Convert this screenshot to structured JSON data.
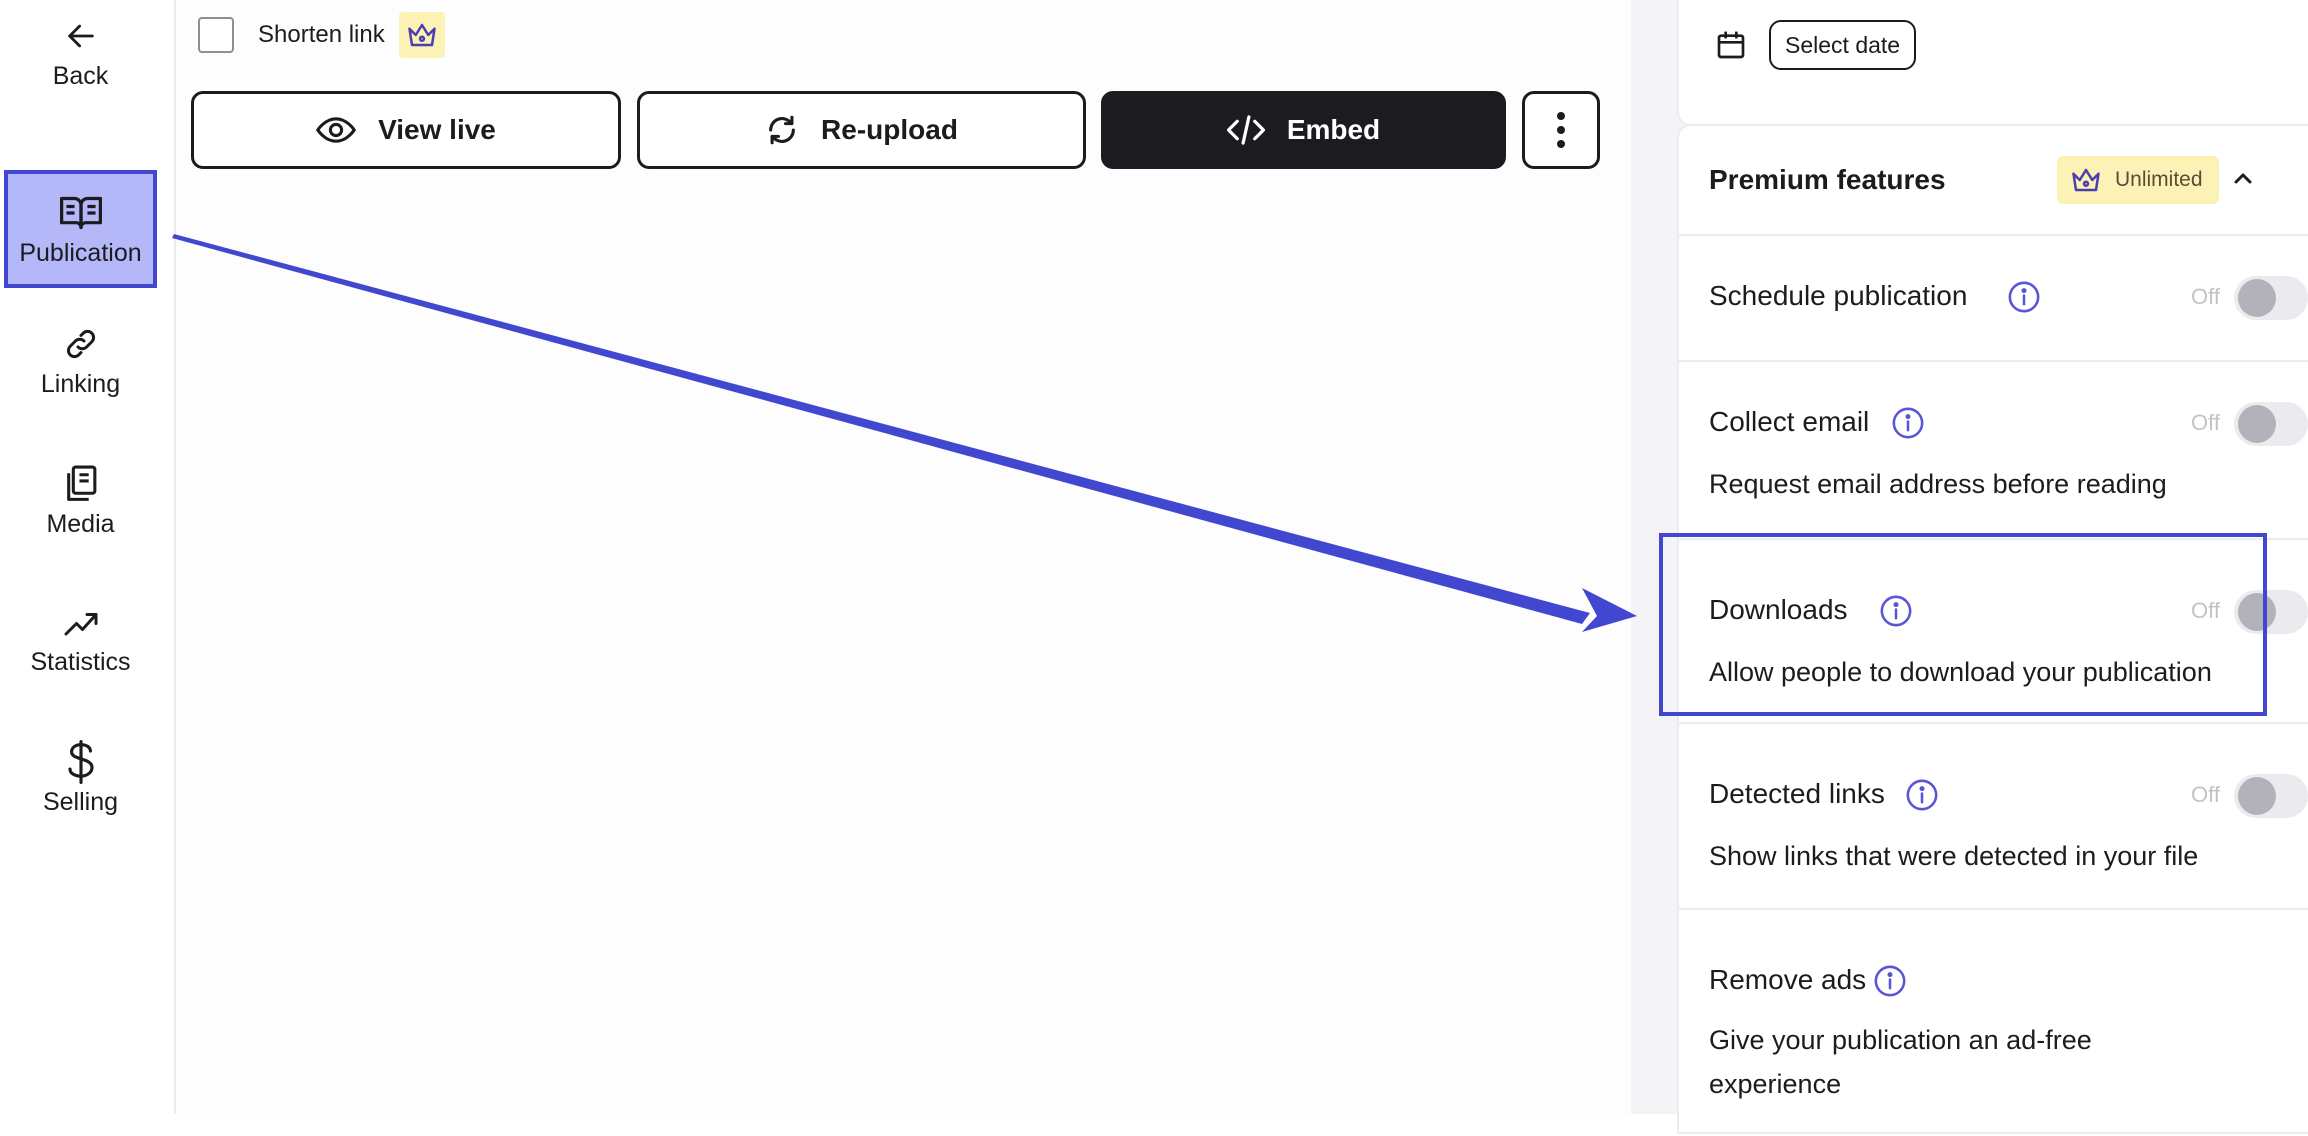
{
  "sidebar": {
    "back_label": "Back",
    "items": [
      {
        "label": "Publication",
        "icon": "book-open-icon",
        "active": true
      },
      {
        "label": "Linking",
        "icon": "link-icon"
      },
      {
        "label": "Media",
        "icon": "media-copy-icon"
      },
      {
        "label": "Statistics",
        "icon": "trending-up-icon"
      },
      {
        "label": "Selling",
        "icon": "dollar-icon"
      }
    ]
  },
  "main": {
    "shorten_link_label": "Shorten link",
    "buttons": {
      "view_live": "View live",
      "reupload": "Re-upload",
      "embed": "Embed"
    }
  },
  "panel": {
    "select_date_label": "Select date",
    "premium": {
      "title": "Premium features",
      "badge": "Unlimited",
      "features": [
        {
          "title": "Schedule publication",
          "state": "Off",
          "description": ""
        },
        {
          "title": "Collect email",
          "state": "Off",
          "description": "Request email address before reading"
        },
        {
          "title": "Downloads",
          "state": "Off",
          "description": "Allow people to download your publication"
        },
        {
          "title": "Detected links",
          "state": "Off",
          "description": "Show links that were detected in your file"
        },
        {
          "title": "Remove ads",
          "state": "",
          "description": "Give your publication an ad-free experience"
        }
      ]
    }
  },
  "colors": {
    "accent": "#4148cf",
    "active_nav_bg": "#b4b7f8",
    "premium_badge_bg": "#fdf2b5",
    "info_icon": "#5a55d6",
    "dark_button": "#1c1b1f"
  }
}
